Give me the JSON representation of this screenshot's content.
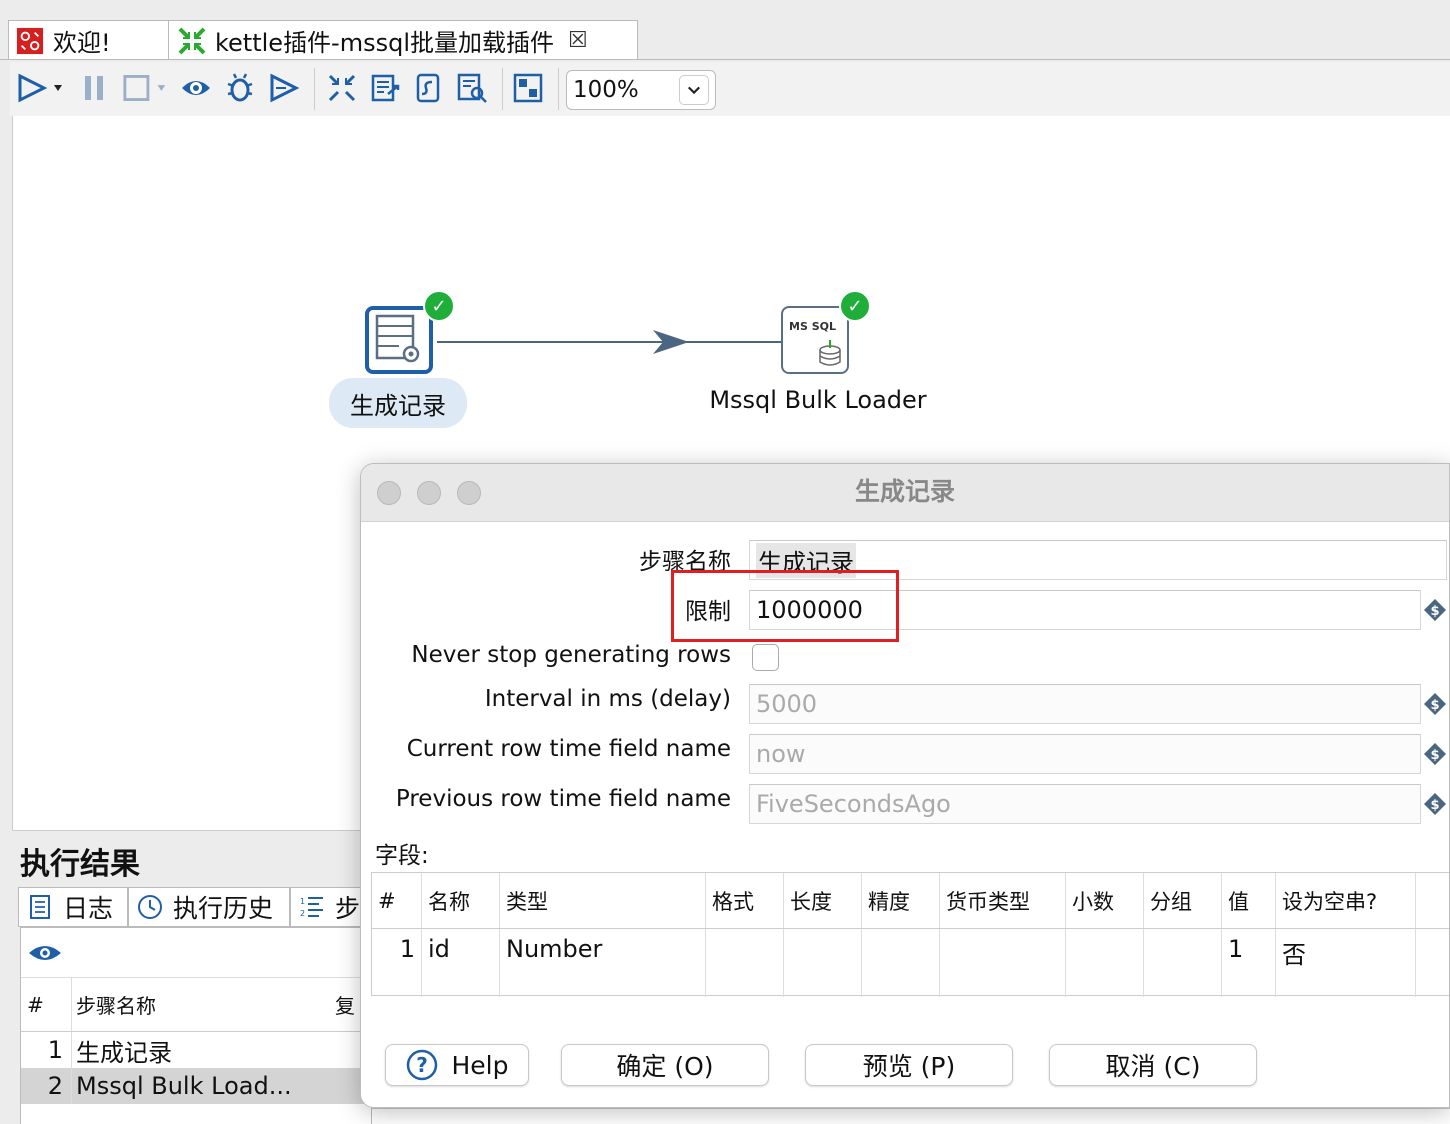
{
  "tabs": [
    {
      "label": "欢迎!",
      "icon": "spoon-icon"
    },
    {
      "label": "kettle插件-mssql批量加载插件",
      "icon": "transformation-icon",
      "close": "☒"
    }
  ],
  "toolbar": {
    "icons": [
      "run-icon",
      "pause-icon",
      "stop-icon",
      "preview-icon",
      "debug-icon",
      "replay-icon",
      "verify-icon",
      "impact-icon",
      "sql-icon",
      "explore-db-icon",
      "snap-grid-icon"
    ],
    "zoom": "100%"
  },
  "canvas": {
    "step1": {
      "label": "生成记录",
      "status": "ok"
    },
    "step2": {
      "label": "Mssql Bulk Loader",
      "icon_text": "MS SQL",
      "status": "ok"
    }
  },
  "results": {
    "title": "执行结果",
    "tabs": [
      "日志",
      "执行历史",
      "步"
    ],
    "columns": {
      "num": "#",
      "name": "步骤名称",
      "extra": "复"
    },
    "rows": [
      {
        "num": "1",
        "name": "生成记录"
      },
      {
        "num": "2",
        "name": "Mssql Bulk Load..."
      }
    ]
  },
  "dialog": {
    "title": "生成记录",
    "fields": {
      "step_name": {
        "label": "步骤名称",
        "value": "生成记录"
      },
      "limit": {
        "label": "限制",
        "value": "1000000"
      },
      "never_stop": {
        "label": "Never stop generating rows",
        "checked": false
      },
      "interval": {
        "label": "Interval in ms (delay)",
        "value": "5000"
      },
      "current_row": {
        "label": "Current row time field name",
        "value": "now"
      },
      "previous_row": {
        "label": "Previous row time field name",
        "value": "FiveSecondsAgo"
      }
    },
    "fields_label": "字段:",
    "grid": {
      "columns": [
        "#",
        "名称",
        "类型",
        "格式",
        "长度",
        "精度",
        "货币类型",
        "小数",
        "分组",
        "值",
        "设为空串?"
      ],
      "rows": [
        [
          "1",
          "id",
          "Number",
          "",
          "",
          "",
          "",
          "",
          "",
          "1",
          "否"
        ]
      ]
    },
    "buttons": {
      "help": "Help",
      "ok": "确定 (O)",
      "preview": "预览 (P)",
      "cancel": "取消 (C)"
    }
  },
  "colors": {
    "accent": "#1f5fa8",
    "ok_green": "#1fae3a",
    "highlight_red": "#e02020"
  }
}
